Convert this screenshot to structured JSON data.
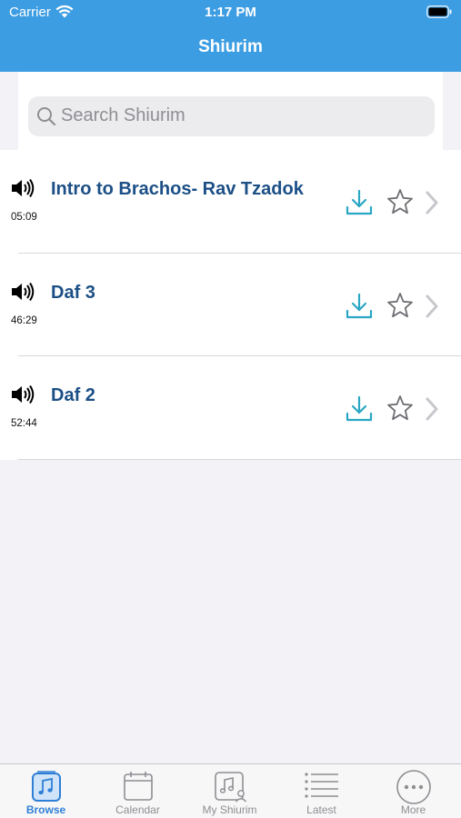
{
  "status_bar": {
    "carrier": "Carrier",
    "time": "1:17 PM"
  },
  "nav": {
    "title": "Shiurim"
  },
  "search": {
    "placeholder": "Search Shiurim"
  },
  "shiurim": [
    {
      "title": "Intro to Brachos- Rav Tzadok",
      "duration": "05:09"
    },
    {
      "title": "Daf 3",
      "duration": "46:29"
    },
    {
      "title": "Daf 2",
      "duration": "52:44"
    }
  ],
  "tabs": [
    {
      "label": "Browse",
      "icon": "music-note-icon",
      "active": true
    },
    {
      "label": "Calendar",
      "icon": "calendar-icon",
      "active": false
    },
    {
      "label": "My Shiurim",
      "icon": "music-person-icon",
      "active": false
    },
    {
      "label": "Latest",
      "icon": "list-icon",
      "active": false
    },
    {
      "label": "More",
      "icon": "more-icon",
      "active": false
    }
  ],
  "colors": {
    "nav_bar": "#3d9de2",
    "title_text": "#1b4f86",
    "download_icon": "#2aa7c4",
    "tab_active": "#2f7fd6"
  }
}
